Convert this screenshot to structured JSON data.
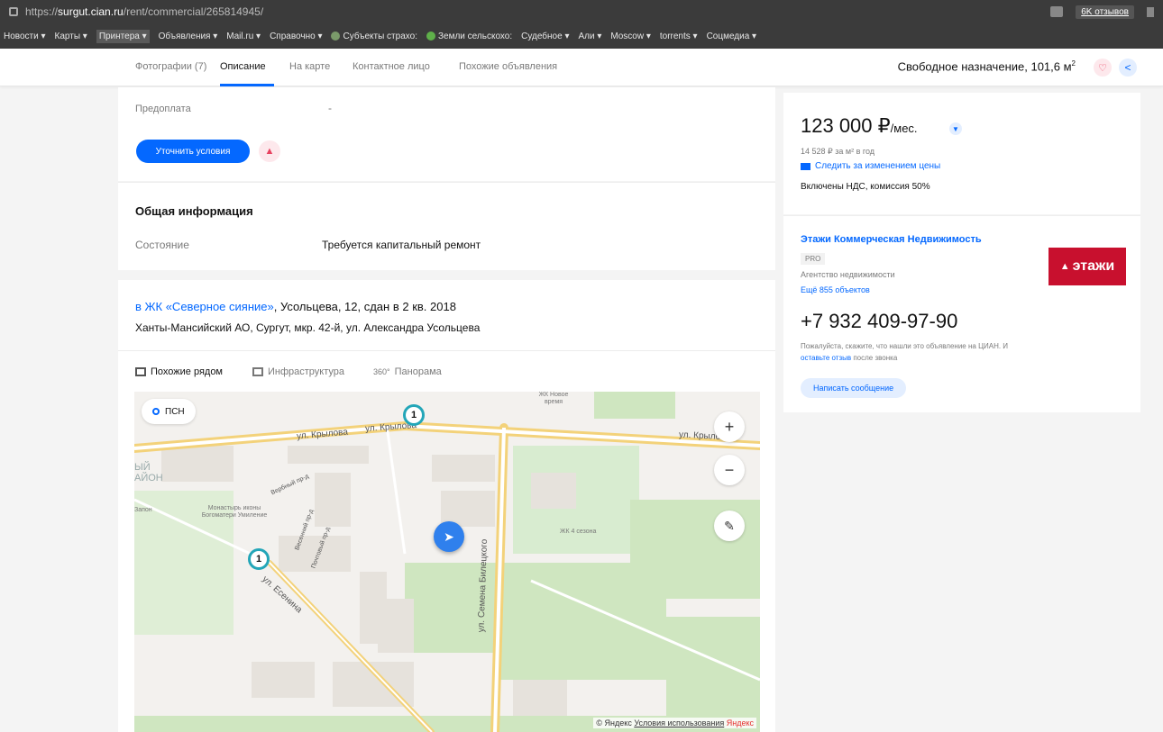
{
  "browser": {
    "url_prefix": "https://",
    "url_domain": "surgut.cian.ru",
    "url_path": "/rent/commercial/265814945/",
    "reviews_badge": "6K отзывов"
  },
  "bookmarks": [
    {
      "label": "Новости ▾"
    },
    {
      "label": "Карты ▾"
    },
    {
      "label": "Принтера ▾"
    },
    {
      "label": "Объявления ▾"
    },
    {
      "label": "Mail.ru ▾"
    },
    {
      "label": "Справочно ▾"
    },
    {
      "label": "Субъекты страхо:"
    },
    {
      "label": "Земли сельскохо:"
    },
    {
      "label": "Судебное ▾"
    },
    {
      "label": "Али ▾"
    },
    {
      "label": "Moscow ▾"
    },
    {
      "label": "torrents ▾"
    },
    {
      "label": "Соцмедиа ▾"
    }
  ],
  "nav": {
    "tabs": [
      "Фотографии (7)",
      "Описание",
      "На карте",
      "Контактное лицо",
      "Похожие объявления"
    ],
    "title": "Свободное назначение, 101,6 м",
    "title_sup": "2"
  },
  "conditions": {
    "prepay_label": "Предоплата",
    "prepay_value": "-",
    "clarify_button": "Уточнить условия",
    "warn_icon": "▲"
  },
  "general": {
    "heading": "Общая информация",
    "state_label": "Состояние",
    "state_value": "Требуется капитальный ремонт"
  },
  "location": {
    "complex_link": "в ЖК «Северное сияние»",
    "address_rest": ", Усольцева, 12, сдан в 2 кв. 2018",
    "address_full": "Ханты-Мансийский АО, Сургут, мкр. 42-й, ул. Александра Усольцева",
    "map_tabs": [
      "Похожие рядом",
      "Инфраструктура",
      "Панорама"
    ]
  },
  "map": {
    "psn_label": "ПСН",
    "zoom_in": "+",
    "zoom_out": "−",
    "ruler_icon": "✎",
    "cluster_1": "1",
    "cluster_2": "1",
    "streets": [
      "ул. Крылова",
      "ул. Крылова",
      "ул. Крылова",
      "ул. Семена Билецкого",
      "ул. Есенина",
      "Вербный пр-д",
      "Весенний пр-д",
      "Почтовый пр-д"
    ],
    "pois": [
      "Монастырь иконы Богоматери Умиление",
      "ЖК 4 сезона",
      "ЖК Новое время",
      "ЫЙ АЙОН",
      "Запон"
    ],
    "copyright_prefix": "© Яндекс ",
    "copyright_link": "Условия использования",
    "copyright_brand": " Яндекс"
  },
  "price": {
    "amount": "123 000 ₽",
    "per": "/мес.",
    "per_sqm": "14 528 ₽ за м² в год",
    "track": "Следить за изменением цены",
    "vat": "Включены НДС, комиссия 50%"
  },
  "agent": {
    "name": "Этажи Коммерческая Недвижимость",
    "badge": "PRO",
    "type": "Агентство недвижимости",
    "more": "Ещё 855 объектов",
    "logo_text": "этажи",
    "phone": "+7 932 409-97-90",
    "note_prefix": "Пожалуйста, скажите, что нашли это объявление на ЦИАН. И ",
    "note_link": "оставьте отзыв",
    "note_suffix": " после звонка",
    "message_button": "Написать сообщение"
  },
  "colors": {
    "accent": "#0468ff",
    "danger": "#e84260",
    "brand_logo": "#c8102e"
  }
}
